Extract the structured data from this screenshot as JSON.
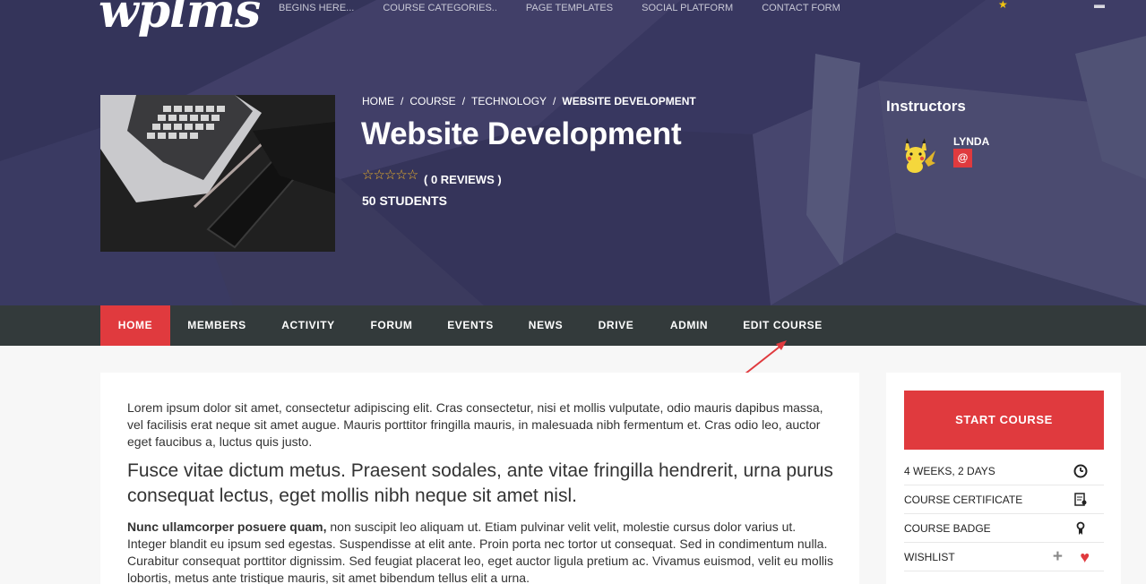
{
  "site": {
    "logo_text": "wplms"
  },
  "topnav": {
    "items": [
      "BEGINS HERE...",
      "COURSE CATEGORIES..",
      "PAGE TEMPLATES",
      "SOCIAL PLATFORM",
      "CONTACT FORM"
    ]
  },
  "breadcrumb": {
    "items": [
      "HOME",
      "COURSE",
      "TECHNOLOGY"
    ],
    "separator": "/",
    "current": "WEBSITE DEVELOPMENT"
  },
  "course": {
    "title": "Website Development",
    "stars": "☆☆☆☆☆",
    "rating": 0,
    "reviews_label": "( 0 REVIEWS )",
    "students_label": "50 STUDENTS"
  },
  "instructors": {
    "heading": "Instructors",
    "items": [
      {
        "name": "LYNDA",
        "contact_icon": "@"
      }
    ]
  },
  "course_nav": {
    "tabs": [
      "HOME",
      "MEMBERS",
      "ACTIVITY",
      "FORUM",
      "EVENTS",
      "NEWS",
      "DRIVE",
      "ADMIN",
      "EDIT COURSE"
    ],
    "active": "HOME"
  },
  "content": {
    "p1": "Lorem ipsum dolor sit amet, consectetur adipiscing elit. Cras consectetur, nisi et mollis vulputate, odio mauris dapibus massa, vel facilisis erat neque sit amet augue. Mauris porttitor fringilla mauris, in malesuada nibh fermentum et. Cras odio leo, auctor eget faucibus a, luctus quis justo.",
    "p2": "Fusce vitae dictum metus. Praesent sodales, ante vitae fringilla hendrerit, urna purus consequat lectus, eget mollis nibh neque sit amet nisl.",
    "p3_bold": "Nunc ullamcorper posuere quam,",
    "p3_rest": " non suscipit leo aliquam ut. Etiam pulvinar velit velit, molestie cursus dolor varius ut. Integer blandit eu ipsum sed egestas. Suspendisse at elit ante. Proin porta nec tortor ut consequat. Sed in condimentum nulla. Curabitur consequat porttitor dignissim. Sed feugiat placerat leo, eget auctor ligula pretium ac. Vivamus euismod, velit eu mollis lobortis, metus ante tristique mauris, sit amet bibendum tellus elit a urna."
  },
  "sidebar": {
    "start_button": "START COURSE",
    "rows": [
      {
        "label": "4 WEEKS, 2 DAYS",
        "icon": "clock-icon"
      },
      {
        "label": "COURSE CERTIFICATE",
        "icon": "certificate-icon"
      },
      {
        "label": "COURSE BADGE",
        "icon": "badge-icon"
      },
      {
        "label": "WISHLIST",
        "icon": "heart-icon"
      }
    ]
  },
  "colors": {
    "accent": "#e03a3e",
    "hero_bg": "#3b3a5e",
    "nav_bg": "#333a3b",
    "star": "#f0b429"
  }
}
